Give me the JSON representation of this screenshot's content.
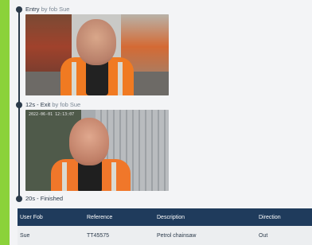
{
  "timeline": {
    "events": [
      {
        "time": "Entry",
        "action": "by fob Sue",
        "has_snapshot": true
      },
      {
        "time": "12s - Exit",
        "action": "by fob Sue",
        "has_snapshot": true
      },
      {
        "time": "20s - Finished",
        "action": "",
        "has_snapshot": false
      }
    ],
    "snapshot_timestamp": "2022-06-01 12:13:07"
  },
  "log_table": {
    "columns": [
      "User Fob",
      "Reference",
      "Description",
      "Direction"
    ],
    "rows": [
      [
        "Sue",
        "TT45575",
        "Petrol chainsaw",
        "Out"
      ]
    ]
  },
  "colors": {
    "frame_green": "#8bd23a",
    "header_navy": "#1f3b5c",
    "timeline": "#2b3a4a"
  }
}
